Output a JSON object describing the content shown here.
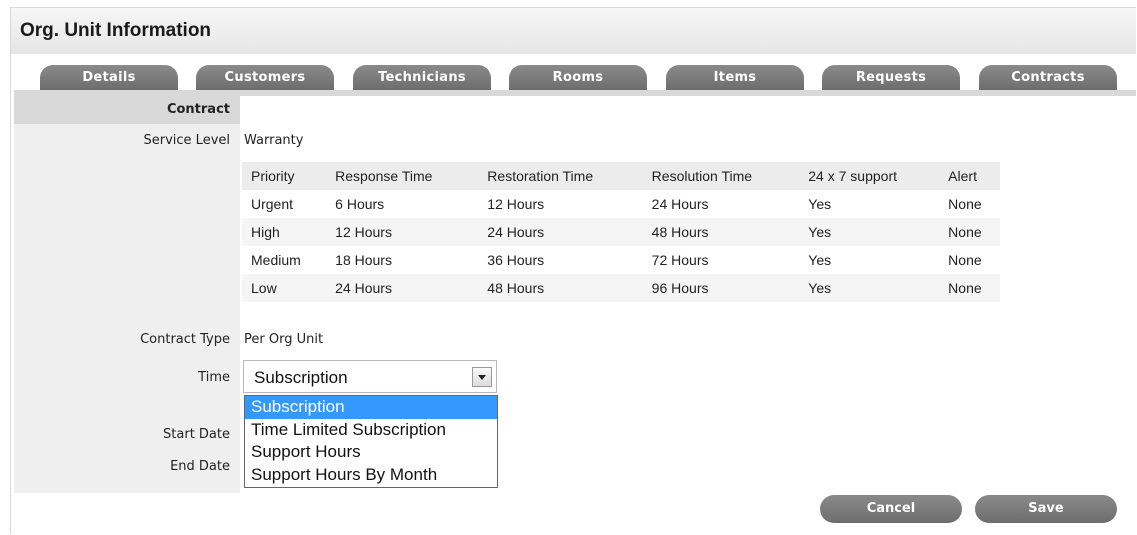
{
  "header": {
    "title": "Org. Unit Information"
  },
  "tabs": [
    {
      "label": "Details"
    },
    {
      "label": "Customers"
    },
    {
      "label": "Technicians"
    },
    {
      "label": "Rooms"
    },
    {
      "label": "Items"
    },
    {
      "label": "Requests"
    },
    {
      "label": "Contracts"
    }
  ],
  "form": {
    "section_title": "Contract",
    "service_level_label": "Service Level",
    "service_level_value": "Warranty",
    "contract_type_label": "Contract Type",
    "contract_type_value": "Per Org Unit",
    "time_label": "Time",
    "time_selected": "Subscription",
    "time_options": [
      "Subscription",
      "Time Limited Subscription",
      "Support Hours",
      "Support Hours By Month"
    ],
    "start_date_label": "Start Date",
    "end_date_label": "End Date"
  },
  "sla_table": {
    "headers": [
      "Priority",
      "Response Time",
      "Restoration Time",
      "Resolution Time",
      "24 x 7 support",
      "Alert"
    ],
    "rows": [
      [
        "Urgent",
        "6 Hours",
        "12 Hours",
        "24 Hours",
        "Yes",
        "None"
      ],
      [
        "High",
        "12 Hours",
        "24 Hours",
        "48 Hours",
        "Yes",
        "None"
      ],
      [
        "Medium",
        "18 Hours",
        "36 Hours",
        "72 Hours",
        "Yes",
        "None"
      ],
      [
        "Low",
        "24 Hours",
        "48 Hours",
        "96 Hours",
        "Yes",
        "None"
      ]
    ]
  },
  "actions": {
    "cancel_label": "Cancel",
    "save_label": "Save"
  },
  "colors": {
    "tab_gray": "#777777",
    "selected_blue": "#3399ff",
    "header_bg": "#e6e6e6"
  }
}
